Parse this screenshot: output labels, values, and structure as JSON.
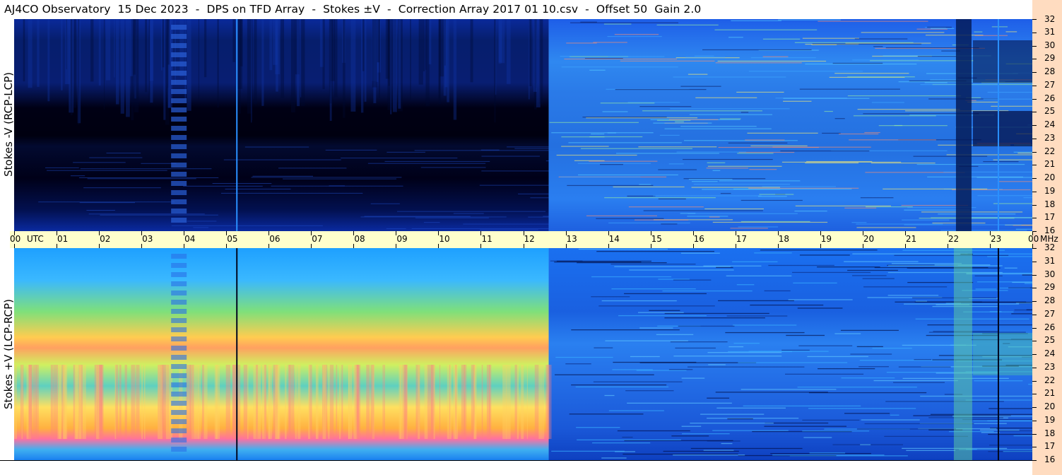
{
  "header": {
    "title": "AJ4CO Observatory  15 Dec 2023  -  DPS on TFD Array  -  Stokes ±V  -  Correction Array 2017 01 10.csv  -  Offset 50  Gain 2.0"
  },
  "panels": {
    "top_label": "Stokes -V (RCP-LCP)",
    "bottom_label": "Stokes +V (LCP-RCP)"
  },
  "time_axis": {
    "ticks": [
      "00",
      "01",
      "02",
      "03",
      "04",
      "05",
      "06",
      "07",
      "08",
      "09",
      "10",
      "11",
      "12",
      "13",
      "14",
      "15",
      "16",
      "17",
      "18",
      "19",
      "20",
      "21",
      "22",
      "23",
      "00"
    ],
    "unit_label": "UTC",
    "freq_unit": "MHz"
  },
  "colors": {
    "background": "#ffffff",
    "time_bar": "#ffffcc",
    "right_strip": "#ffdcc0",
    "spectrogram_low": "#000018",
    "spectrogram_mid": "#2a7fff",
    "spectrogram_high": "#ff40a0"
  },
  "chart_data": {
    "type": "heatmap",
    "title": "AJ4CO Observatory  15 Dec 2023  -  DPS on TFD Array  -  Stokes ±V  -  Correction Array 2017 01 10.csv  -  Offset 50  Gain 2.0",
    "x_range_utc_hours": [
      0,
      24
    ],
    "y_range_mhz": [
      16,
      32
    ],
    "y_ticks": [
      32,
      31,
      30,
      29,
      28,
      27,
      26,
      25,
      24,
      23,
      22,
      21,
      20,
      19,
      18,
      17,
      16
    ],
    "panels": [
      {
        "name": "Stokes -V (RCP-LCP)",
        "night_segment_utc": [
          0,
          12.6
        ],
        "day_segment_utc": [
          12.6,
          24
        ]
      },
      {
        "name": "Stokes +V (LCP-RCP)",
        "night_segment_utc": [
          0,
          12.6
        ],
        "day_segment_utc": [
          12.6,
          24
        ]
      }
    ],
    "vertical_marks_utc": [
      5.25,
      23.2
    ]
  }
}
